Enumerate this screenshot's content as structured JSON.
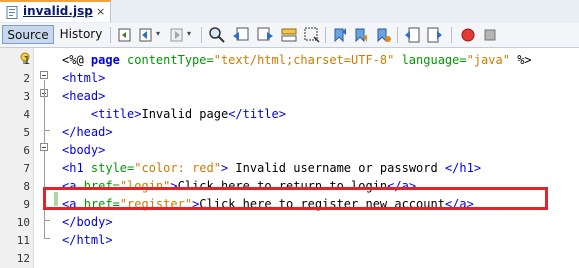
{
  "tab": {
    "title": "invalid.jsp",
    "close": "×",
    "icon": "jsp-file-icon"
  },
  "toolbar": {
    "source_label": "Source",
    "history_label": "History",
    "icons": [
      "last-edit-icon",
      "back-icon",
      "forward-icon",
      "find-icon",
      "find-previous-icon",
      "find-next-icon",
      "toggle-highlight-icon",
      "toggle-rect-selection-icon",
      "previous-bookmark-icon",
      "next-bookmark-icon",
      "toggle-bookmark-icon",
      "shift-left-icon",
      "shift-right-icon",
      "start-macro-icon",
      "stop-macro-icon"
    ]
  },
  "editor": {
    "line_numbers": [
      "1",
      "2",
      "3",
      "4",
      "5",
      "6",
      "7",
      "8",
      "9",
      "10",
      "11",
      "12"
    ],
    "lines": [
      {
        "parts": [
          {
            "t": "<%@ ",
            "c": "dir"
          },
          {
            "t": "page",
            "c": "kw"
          },
          {
            "t": " contentType=",
            "c": "attr"
          },
          {
            "t": "\"text/html;charset=UTF-8\"",
            "c": "val"
          },
          {
            "t": " language=",
            "c": "attr"
          },
          {
            "t": "\"java\"",
            "c": "val"
          },
          {
            "t": " %>",
            "c": "dir"
          }
        ]
      },
      {
        "parts": [
          {
            "t": "<html>",
            "c": "tag"
          }
        ]
      },
      {
        "parts": [
          {
            "t": "<head>",
            "c": "tag"
          }
        ]
      },
      {
        "parts": [
          {
            "t": "    ",
            "c": "txt"
          },
          {
            "t": "<title>",
            "c": "tag"
          },
          {
            "t": "Invalid page",
            "c": "txt"
          },
          {
            "t": "</title>",
            "c": "tag"
          }
        ]
      },
      {
        "parts": [
          {
            "t": "</head>",
            "c": "tag"
          }
        ]
      },
      {
        "parts": [
          {
            "t": "<body>",
            "c": "tag"
          }
        ]
      },
      {
        "parts": [
          {
            "t": "<h1 ",
            "c": "tag"
          },
          {
            "t": "style=",
            "c": "attr"
          },
          {
            "t": "\"color: red\"",
            "c": "val"
          },
          {
            "t": ">",
            "c": "tag"
          },
          {
            "t": " Invalid username or password ",
            "c": "txt"
          },
          {
            "t": "</h1>",
            "c": "tag"
          }
        ]
      },
      {
        "parts": [
          {
            "t": "<a ",
            "c": "tag"
          },
          {
            "t": "href=",
            "c": "attr"
          },
          {
            "t": "\"login\"",
            "c": "val"
          },
          {
            "t": ">",
            "c": "tag"
          },
          {
            "t": "Click here to return to login",
            "c": "txt"
          },
          {
            "t": "</a>",
            "c": "tag"
          }
        ]
      },
      {
        "parts": [
          {
            "t": "<a ",
            "c": "tag"
          },
          {
            "t": "href=",
            "c": "attr"
          },
          {
            "t": "\"register\"",
            "c": "val"
          },
          {
            "t": ">",
            "c": "tag"
          },
          {
            "t": "Click here to register new account",
            "c": "txt"
          },
          {
            "t": "</a>",
            "c": "tag"
          }
        ]
      },
      {
        "parts": [
          {
            "t": "</body>",
            "c": "tag"
          }
        ]
      },
      {
        "parts": [
          {
            "t": "</html>",
            "c": "tag"
          }
        ]
      },
      {
        "parts": []
      }
    ],
    "highlighted_line": "9",
    "highlight_color": "#e0242b"
  }
}
